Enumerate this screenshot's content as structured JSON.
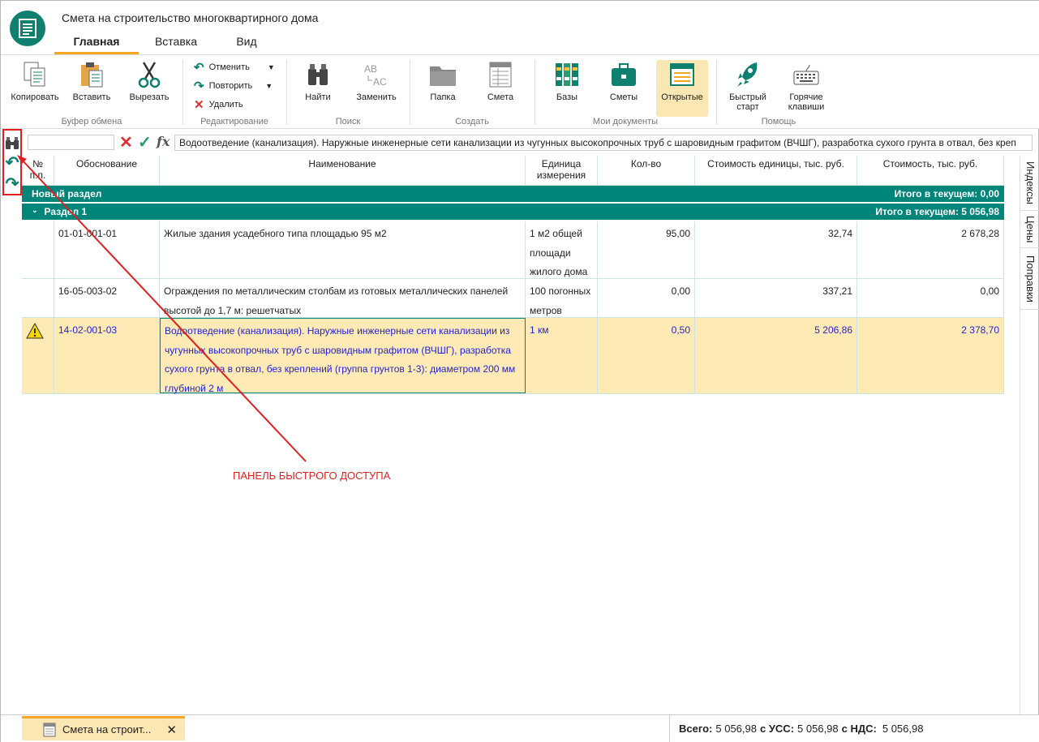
{
  "window": {
    "title": "Смета на строительство многоквартирного дома"
  },
  "tabs": [
    {
      "label": "Главная"
    },
    {
      "label": "Вставка"
    },
    {
      "label": "Вид"
    }
  ],
  "ribbon": {
    "clipboard": {
      "copy": "Копировать",
      "paste": "Вставить",
      "cut": "Вырезать",
      "group": "Буфер обмена"
    },
    "editing": {
      "undo": "Отменить",
      "redo": "Повторить",
      "delete": "Удалить",
      "group": "Редактирование"
    },
    "search": {
      "find": "Найти",
      "replace": "Заменить",
      "group": "Поиск"
    },
    "create": {
      "folder": "Папка",
      "estimate": "Смета",
      "group": "Создать"
    },
    "mydocs": {
      "bases": "Базы",
      "estimates": "Сметы",
      "open": "Открытые",
      "group": "Мои документы"
    },
    "help": {
      "quickstart_l1": "Быстрый",
      "quickstart_l2": "старт",
      "hotkeys_l1": "Горячие",
      "hotkeys_l2": "клавиши",
      "group": "Помощь"
    }
  },
  "formula_bar": {
    "value": "Водоотведение (канализация). Наружные инженерные сети канализации из чугунных высокопрочных труб с шаровидным графитом (ВЧШГ), разработка сухого грунта в отвал, без креп"
  },
  "table": {
    "headers": {
      "num_l1": "№",
      "num_l2": "п.п.",
      "basis": "Обоснование",
      "name": "Наименование",
      "unit_l1": "Единица",
      "unit_l2": "измерения",
      "qty": "Кол-во",
      "unit_cost": "Стоимость единицы, тыс. руб.",
      "cost": "Стоимость, тыс. руб."
    },
    "sections": [
      {
        "name": "Новый раздел",
        "total": "Итого в текущем: 0,00"
      },
      {
        "name": "Раздел 1",
        "total": "Итого в текущем: 5 056,98"
      }
    ],
    "rows": [
      {
        "basis": "01-01-001-01",
        "name": "Жилые здания усадебного типа площадью 95 м2",
        "unit": "1 м2 общей площади жилого дома",
        "qty": "95,00",
        "unit_cost": "32,74",
        "cost": "2 678,28"
      },
      {
        "basis": "16-05-003-02",
        "name": "Ограждения по металлическим столбам из готовых металлических панелей высотой до 1,7 м: решетчатых",
        "unit": "100 погонных метров",
        "qty": "0,00",
        "unit_cost": "337,21",
        "cost": "0,00"
      },
      {
        "basis": "14-02-001-03",
        "name": "Водоотведение (канализация). Наружные инженерные сети канализации из чугунных высокопрочных труб с шаровидным графитом (ВЧШГ), разработка сухого грунта в отвал, без креплений (группа грунтов 1-3): диаметром 200 мм глубиной 2 м",
        "unit": "1 км",
        "qty": "0,50",
        "unit_cost": "5 206,86",
        "cost": "2 378,70"
      }
    ]
  },
  "side_tabs": [
    {
      "label": "Индексы"
    },
    {
      "label": "Цены"
    },
    {
      "label": "Поправки"
    }
  ],
  "bottom": {
    "doc_tab": "Смета на строит...",
    "totals": {
      "all_label": "Всего:",
      "all": "5 056,98",
      "uss_label": "с УСС:",
      "uss": "5 056,98",
      "vat_label": "с НДС:",
      "vat": "5 056,98"
    }
  },
  "annotation": {
    "label": "ПАНЕЛЬ БЫСТРОГО ДОСТУПА"
  },
  "colors": {
    "accent": "#00857a",
    "tab_underline": "#f5a623",
    "highlight_row": "#fdeab4",
    "annotation": "#e02020",
    "selected_text": "#2525d0"
  }
}
